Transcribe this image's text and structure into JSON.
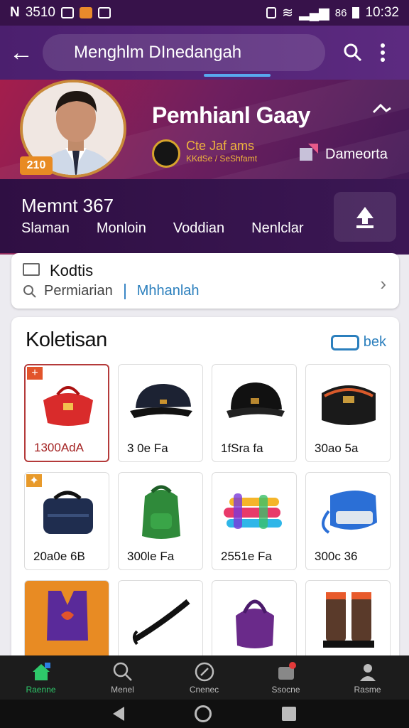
{
  "status_bar": {
    "left_text": "3510",
    "time": "10:32",
    "battery_text": "86"
  },
  "app_bar": {
    "title": "Menghlm DInedangah"
  },
  "hero": {
    "player_name": "Pemhianl Gaay",
    "level": "210",
    "club_name": "Cte Jaf ams",
    "club_sub": "KKdSe / SeShfamt",
    "location_label": "Dameorta"
  },
  "stats": {
    "title": "Memnt 367",
    "tabs": [
      "Slaman",
      "Monloin",
      "Voddian",
      "Nenlclar"
    ]
  },
  "search_card": {
    "title": "Kodtis",
    "placeholder": "Permiarian",
    "link": "Mhhanlah"
  },
  "collection": {
    "title": "Koletisan",
    "more_label": "bek",
    "items": [
      {
        "label": "1300AdA",
        "icon": "red-bag-icon"
      },
      {
        "label": "3 0e Fa",
        "icon": "black-cap-icon"
      },
      {
        "label": "1fSra fa",
        "icon": "black-cap-icon"
      },
      {
        "label": "30ao 5a",
        "icon": "black-bag-icon"
      },
      {
        "label": "20a0e 6B",
        "icon": "navy-duffel-icon"
      },
      {
        "label": "300le Fa",
        "icon": "green-backpack-icon"
      },
      {
        "label": "2551e Fa",
        "icon": "colorful-toy-icon"
      },
      {
        "label": "300c 36",
        "icon": "blue-case-icon"
      },
      {
        "label": "",
        "icon": "purple-vest-icon"
      },
      {
        "label": "",
        "icon": "black-strap-icon"
      },
      {
        "label": "",
        "icon": "purple-bag-icon"
      },
      {
        "label": "",
        "icon": "boots-icon"
      }
    ]
  },
  "bottom_nav": [
    "Raenne",
    "Menel",
    "Cnenec",
    "Ssocne",
    "Rasme"
  ],
  "colors": {
    "accent": "#2ec86a",
    "primary": "#4b1f6e",
    "link": "#2b7fbd"
  }
}
